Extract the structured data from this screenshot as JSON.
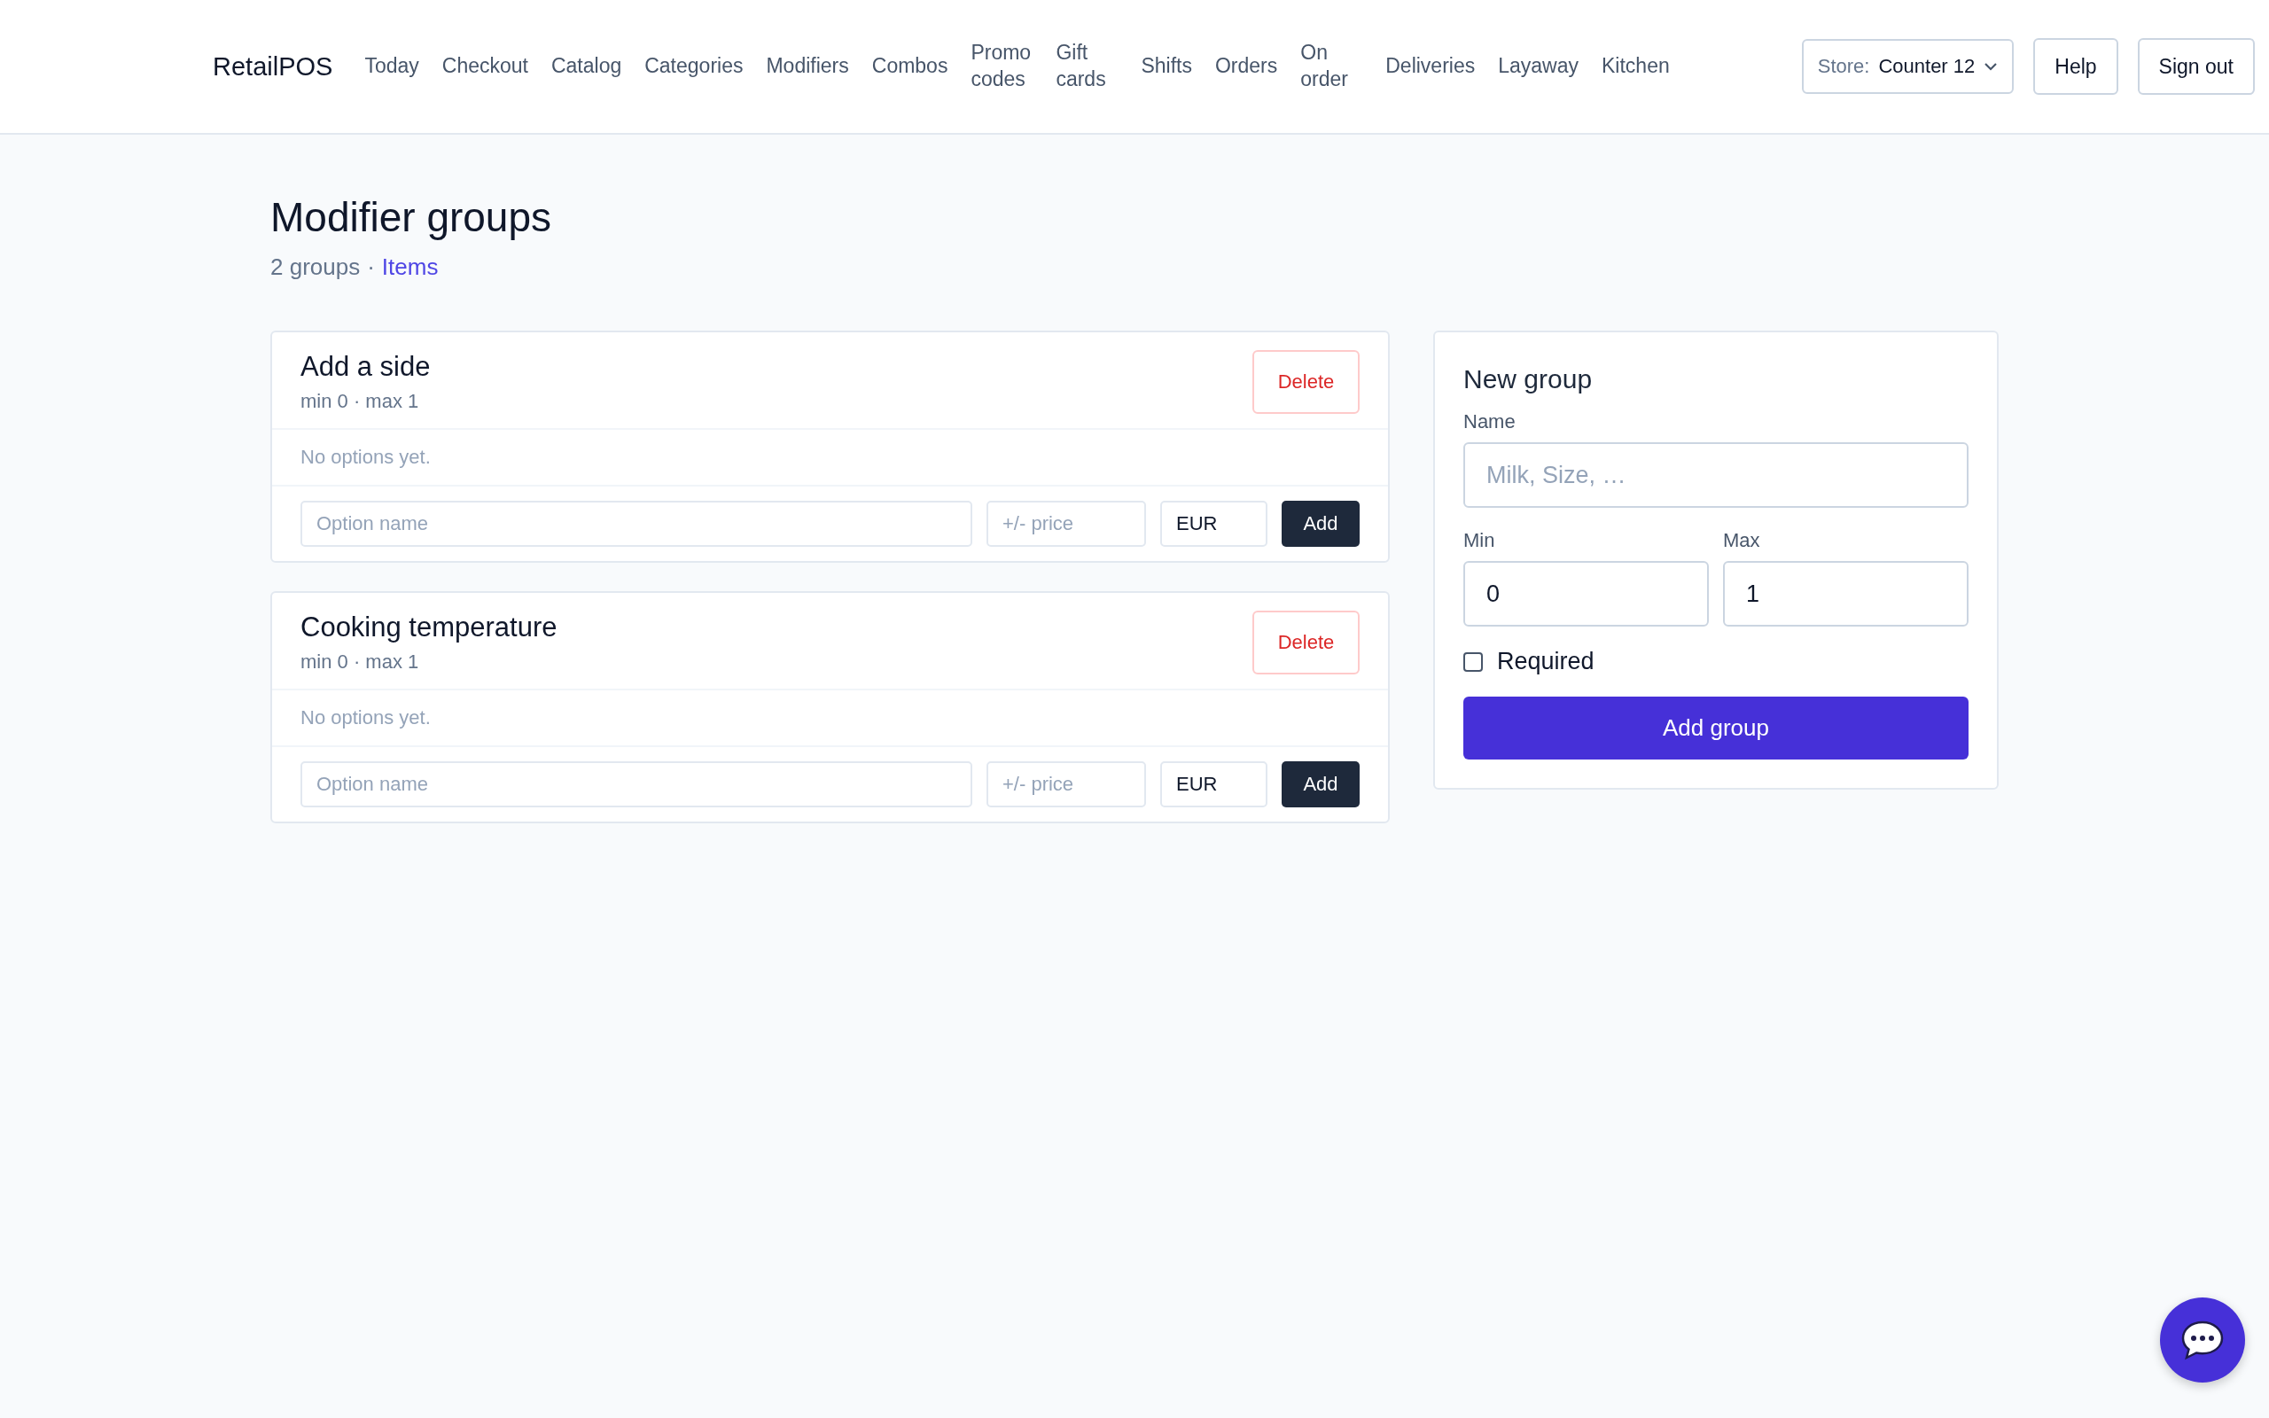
{
  "header": {
    "logo": "RetailPOS",
    "nav": [
      {
        "label": "Today"
      },
      {
        "label": "Checkout"
      },
      {
        "label": "Catalog"
      },
      {
        "label": "Categories"
      },
      {
        "label": "Modifiers"
      },
      {
        "label": "Combos"
      },
      {
        "label": "Promo codes"
      },
      {
        "label": "Gift cards"
      },
      {
        "label": "Shifts"
      },
      {
        "label": "Orders"
      },
      {
        "label": "On order"
      },
      {
        "label": "Deliveries"
      },
      {
        "label": "Layaway"
      },
      {
        "label": "Kitchen"
      }
    ],
    "store": {
      "label": "Store:",
      "value": "Counter 12"
    },
    "buttons": [
      "Help",
      "Sign out"
    ]
  },
  "page": {
    "title": "Modifier groups",
    "count": "2 groups",
    "separator": "·",
    "link": "Items"
  },
  "groups": [
    {
      "name": "Add a side",
      "meta": "min 0 · max 1",
      "delete": "Delete",
      "empty": "No options yet.",
      "option_placeholder": "Option name",
      "price_placeholder": "+/- price",
      "currency": "EUR",
      "add": "Add"
    },
    {
      "name": "Cooking temperature",
      "meta": "min 0 · max 1",
      "delete": "Delete",
      "empty": "No options yet.",
      "option_placeholder": "Option name",
      "price_placeholder": "+/- price",
      "currency": "EUR",
      "add": "Add"
    }
  ],
  "new_group": {
    "title": "New group",
    "name_label": "Name",
    "name_placeholder": "Milk, Size, …",
    "min_label": "Min",
    "min_value": "0",
    "max_label": "Max",
    "max_value": "1",
    "required": {
      "label": "Required",
      "checked": false
    },
    "submit": "Add group"
  }
}
